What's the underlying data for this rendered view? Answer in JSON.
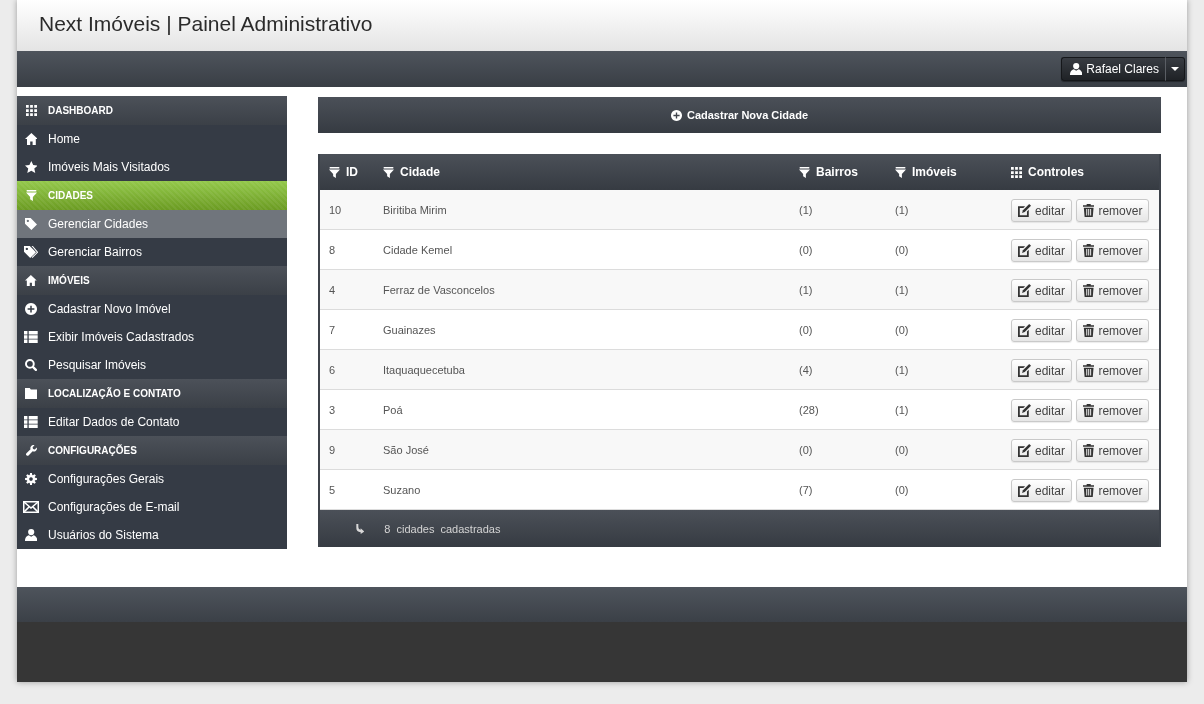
{
  "header": {
    "title": "Next Imóveis | Painel Administrativo"
  },
  "user_menu": {
    "name": "Rafael Clares"
  },
  "sidebar": {
    "sections": [
      {
        "title": "DASHBOARD",
        "selected": false,
        "items": [
          {
            "label": "Home",
            "selected": false
          },
          {
            "label": "Imóveis Mais Visitados",
            "selected": false
          }
        ]
      },
      {
        "title": "CIDADES",
        "selected": true,
        "items": [
          {
            "label": "Gerenciar Cidades",
            "selected": true
          },
          {
            "label": "Gerenciar Bairros",
            "selected": false
          }
        ]
      },
      {
        "title": "IMÓVEIS",
        "selected": false,
        "items": [
          {
            "label": "Cadastrar Novo Imóvel",
            "selected": false
          },
          {
            "label": "Exibir Imóveis Cadastrados",
            "selected": false
          },
          {
            "label": "Pesquisar Imóveis",
            "selected": false
          }
        ]
      },
      {
        "title": "LOCALIZAÇÃO E CONTATO",
        "selected": false,
        "items": [
          {
            "label": "Editar Dados de Contato",
            "selected": false
          }
        ]
      },
      {
        "title": "CONFIGURAÇÕES",
        "selected": false,
        "items": [
          {
            "label": "Configurações Gerais",
            "selected": false
          },
          {
            "label": "Configurações de E-mail",
            "selected": false
          },
          {
            "label": "Usuários do Sistema",
            "selected": false
          }
        ]
      }
    ]
  },
  "main": {
    "add_button": "Cadastrar Nova Cidade",
    "table": {
      "columns": [
        "ID",
        "Cidade",
        "Bairros",
        "Imóveis",
        "Controles"
      ],
      "rows": [
        {
          "id": "10",
          "cidade": "Biritiba Mirim",
          "bairros": "(1)",
          "imoveis": "(1)",
          "actions": [
            "editar",
            "remover"
          ]
        },
        {
          "id": "8",
          "cidade": "Cidade Kemel",
          "bairros": "(0)",
          "imoveis": "(0)",
          "actions": [
            "editar",
            "remover"
          ]
        },
        {
          "id": "4",
          "cidade": "Ferraz de Vasconcelos",
          "bairros": "(1)",
          "imoveis": "(1)",
          "actions": [
            "editar",
            "remover"
          ]
        },
        {
          "id": "7",
          "cidade": "Guainazes",
          "bairros": "(0)",
          "imoveis": "(0)",
          "actions": [
            "editar",
            "remover"
          ]
        },
        {
          "id": "6",
          "cidade": "Itaquaquecetuba",
          "bairros": "(4)",
          "imoveis": "(1)",
          "actions": [
            "editar",
            "remover"
          ]
        },
        {
          "id": "3",
          "cidade": "Poá",
          "bairros": "(28)",
          "imoveis": "(1)",
          "actions": [
            "editar",
            "remover"
          ]
        },
        {
          "id": "9",
          "cidade": "São José",
          "bairros": "(0)",
          "imoveis": "(0)",
          "actions": [
            "editar",
            "remover"
          ]
        },
        {
          "id": "5",
          "cidade": "Suzano",
          "bairros": "(7)",
          "imoveis": "(0)",
          "actions": [
            "editar",
            "remover"
          ]
        }
      ],
      "footer": "8 cidades cadastradas"
    }
  }
}
